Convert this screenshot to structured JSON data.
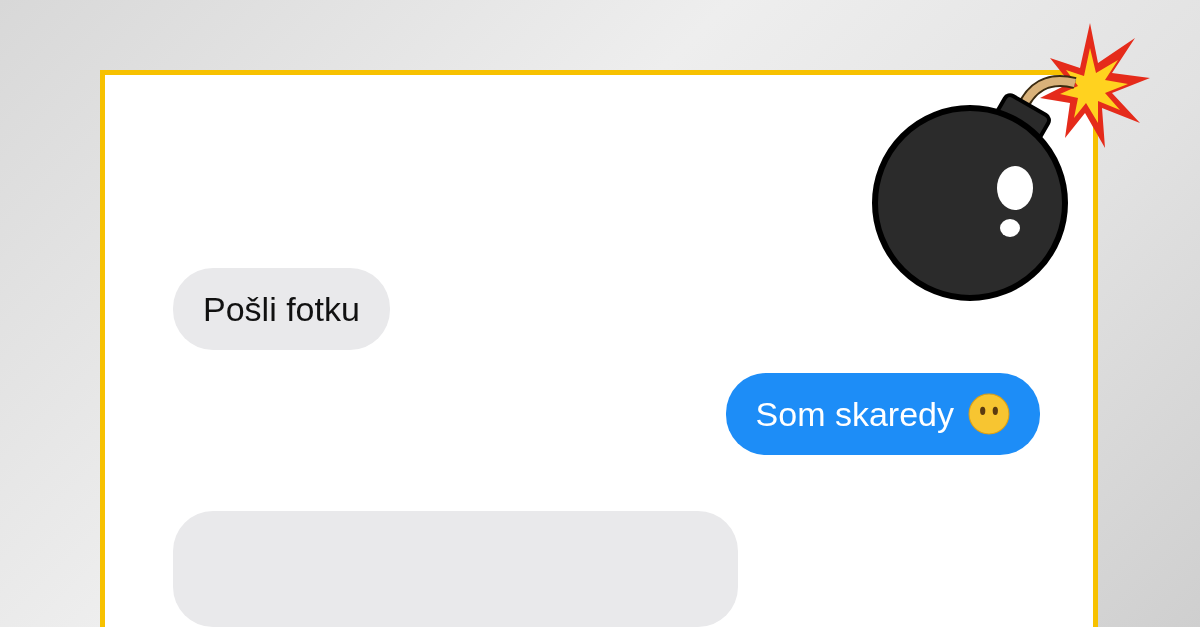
{
  "messages": [
    {
      "kind": "received",
      "text": "Pošli fotku",
      "emoji": false
    },
    {
      "kind": "sent",
      "text": "Som skaredy",
      "emoji": true
    },
    {
      "kind": "cut"
    }
  ]
}
